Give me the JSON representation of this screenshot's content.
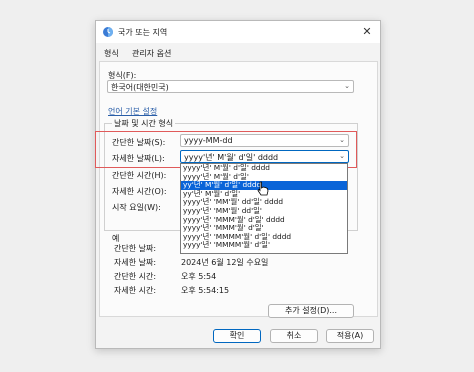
{
  "window": {
    "title": "국가 또는 지역",
    "close_label": "✕"
  },
  "tabs": [
    {
      "label": "형식"
    },
    {
      "label": "관리자 옵션"
    }
  ],
  "format": {
    "label": "형식(F):",
    "value": "한국어(대한민국)"
  },
  "lang_link": "언어 기본 설정",
  "datetime_group": {
    "title": "날짜 및 시간 형식",
    "short_date": {
      "label": "간단한 날짜(S):",
      "value": "yyyy-MM-dd"
    },
    "long_date": {
      "label": "자세한 날짜(L):",
      "value": "yyyy'년' M'월' d'일' dddd"
    },
    "short_time": {
      "label": "간단한 시간(H):"
    },
    "long_time": {
      "label": "자세한 시간(O):"
    },
    "first_day": {
      "label": "시작 요일(W):"
    }
  },
  "dropdown_options": [
    "yyyy'년' M'월' d'일' dddd",
    "yyyy'년' M'월' d'일'",
    "yy'년' M'월' d'일' dddd",
    "yy'년' M'월' d'일'",
    "yyyy'년' 'MM'월' dd'일' dddd",
    "yyyy'년' 'MM'월' dd'일'",
    "yyyy'년' 'MMM'월' d'일' dddd",
    "yyyy'년' 'MMM'월' d'일'",
    "yyyy'년' 'MMMM'월' d'일' dddd",
    "yyyy'년' 'MMMM'월' d'일'"
  ],
  "dropdown_selected_index": 2,
  "example": {
    "title": "예",
    "rows": [
      {
        "label": "간단한 날짜:",
        "value": ""
      },
      {
        "label": "자세한 날짜:",
        "value": "2024년 6월 12일 수요일"
      },
      {
        "label": "간단한 시간:",
        "value": "오후 5:54"
      },
      {
        "label": "자세한 시간:",
        "value": "오후 5:54:15"
      }
    ]
  },
  "more_settings_label": "추가 설정(D)...",
  "buttons": {
    "ok": "확인",
    "cancel": "취소",
    "apply": "적용(A)"
  },
  "colors": {
    "accent": "#0067c0",
    "selection": "#0a64d8",
    "highlight_box": "#e05a5a",
    "link": "#2a5ea8"
  }
}
